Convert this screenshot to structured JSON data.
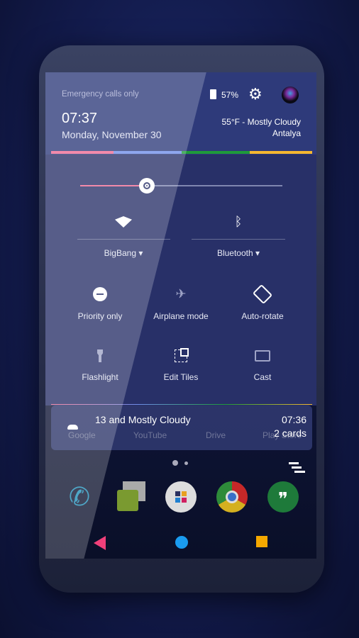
{
  "status": {
    "carrier": "Emergency calls only",
    "battery": "57%",
    "battery_level": 57
  },
  "header": {
    "time": "07:37",
    "date": "Monday, November 30",
    "weather": "55°F - Mostly Cloudy",
    "location": "Antalya"
  },
  "accent_colors": [
    "#ef6a92",
    "#6f8ee8",
    "#1e9a3a",
    "#f5b730"
  ],
  "brightness": {
    "level": 0.33
  },
  "tiles": {
    "wifi": {
      "label": "BigBang"
    },
    "bluetooth": {
      "label": "Bluetooth"
    },
    "priority": {
      "label": "Priority only"
    },
    "airplane": {
      "label": "Airplane mode"
    },
    "autorotate": {
      "label": "Auto-rotate"
    },
    "flashlight": {
      "label": "Flashlight"
    },
    "edit": {
      "label": "Edit Tiles"
    },
    "cast": {
      "label": "Cast"
    }
  },
  "notification": {
    "title": "13 and Mostly Cloudy",
    "time": "07:36",
    "count": "2 cards"
  },
  "background_apps": [
    "Google",
    "YouTube",
    "Drive",
    "Play Store"
  ],
  "dock": [
    "Phone",
    "Messenger",
    "Apps",
    "Chrome",
    "Hangouts"
  ]
}
